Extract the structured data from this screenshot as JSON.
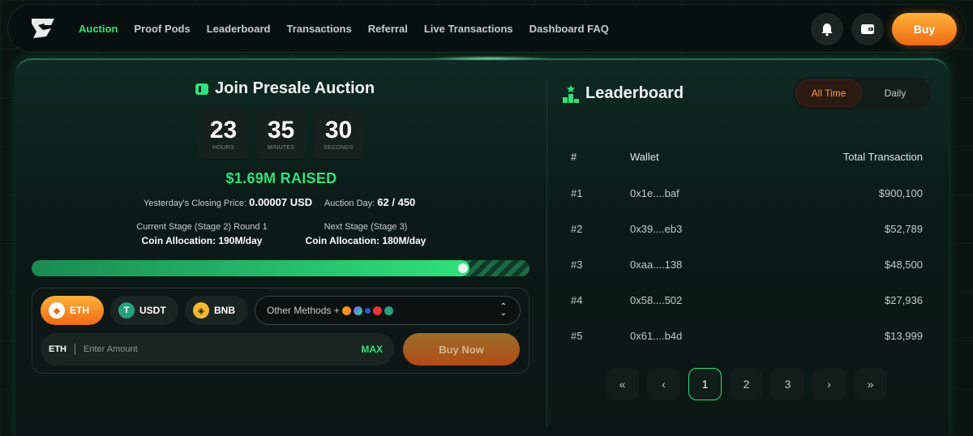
{
  "nav": {
    "links": [
      {
        "label": "Auction",
        "active": true
      },
      {
        "label": "Proof Pods"
      },
      {
        "label": "Leaderboard"
      },
      {
        "label": "Transactions"
      },
      {
        "label": "Referral"
      },
      {
        "label": "Live Transactions"
      },
      {
        "label": "Dashboard FAQ"
      }
    ],
    "buy_label": "Buy",
    "icons": [
      "bell-icon",
      "wallet-icon"
    ]
  },
  "auction": {
    "title": "Join Presale Auction",
    "timer": {
      "hours": "23",
      "hours_label": "HOURS",
      "minutes": "35",
      "minutes_label": "MINUTES",
      "seconds": "30",
      "seconds_label": "SECONDS"
    },
    "raised": "$1.69M RAISED",
    "closing_price_label": "Yesterday's Closing Price:",
    "closing_price_value": "0.00007 USD",
    "auction_day_label": "Auction Day:",
    "auction_day_value": "62 / 450",
    "current_stage": {
      "title": "Current Stage (Stage 2) Round 1",
      "allocation_label": "Coin Allocation:",
      "allocation_value": "190M/day"
    },
    "next_stage": {
      "title": "Next Stage (Stage 3)",
      "allocation_label": "Coin Allocation:",
      "allocation_value": "180M/day"
    },
    "progress_fraction": 0.88
  },
  "payment": {
    "methods": [
      {
        "label": "ETH",
        "active": true
      },
      {
        "label": "USDT"
      },
      {
        "label": "BNB"
      }
    ],
    "other_methods_label": "Other Methods +",
    "amount_currency": "ETH",
    "amount_placeholder": "Enter Amount",
    "max_label": "MAX",
    "buy_now_label": "Buy Now"
  },
  "leaderboard": {
    "title": "Leaderboard",
    "toggle": {
      "all_time": "All Time",
      "daily": "Daily"
    },
    "columns": [
      "#",
      "Wallet",
      "Total Transaction"
    ],
    "rows": [
      {
        "rank": "#1",
        "wallet": "0x1e....baf",
        "total": "$900,100"
      },
      {
        "rank": "#2",
        "wallet": "0x39....eb3",
        "total": "$52,789"
      },
      {
        "rank": "#3",
        "wallet": "0xaa....138",
        "total": "$48,500"
      },
      {
        "rank": "#4",
        "wallet": "0x58....502",
        "total": "$27,936"
      },
      {
        "rank": "#5",
        "wallet": "0x61....b4d",
        "total": "$13,999"
      }
    ],
    "pagination": {
      "first": "«",
      "prev": "‹",
      "pages": [
        "1",
        "2",
        "3"
      ],
      "next": "›",
      "last": "»",
      "current": "1"
    }
  },
  "colors": {
    "accent_green": "#2ee27c",
    "accent_orange": "#f06a14",
    "background": "#0a1512"
  }
}
